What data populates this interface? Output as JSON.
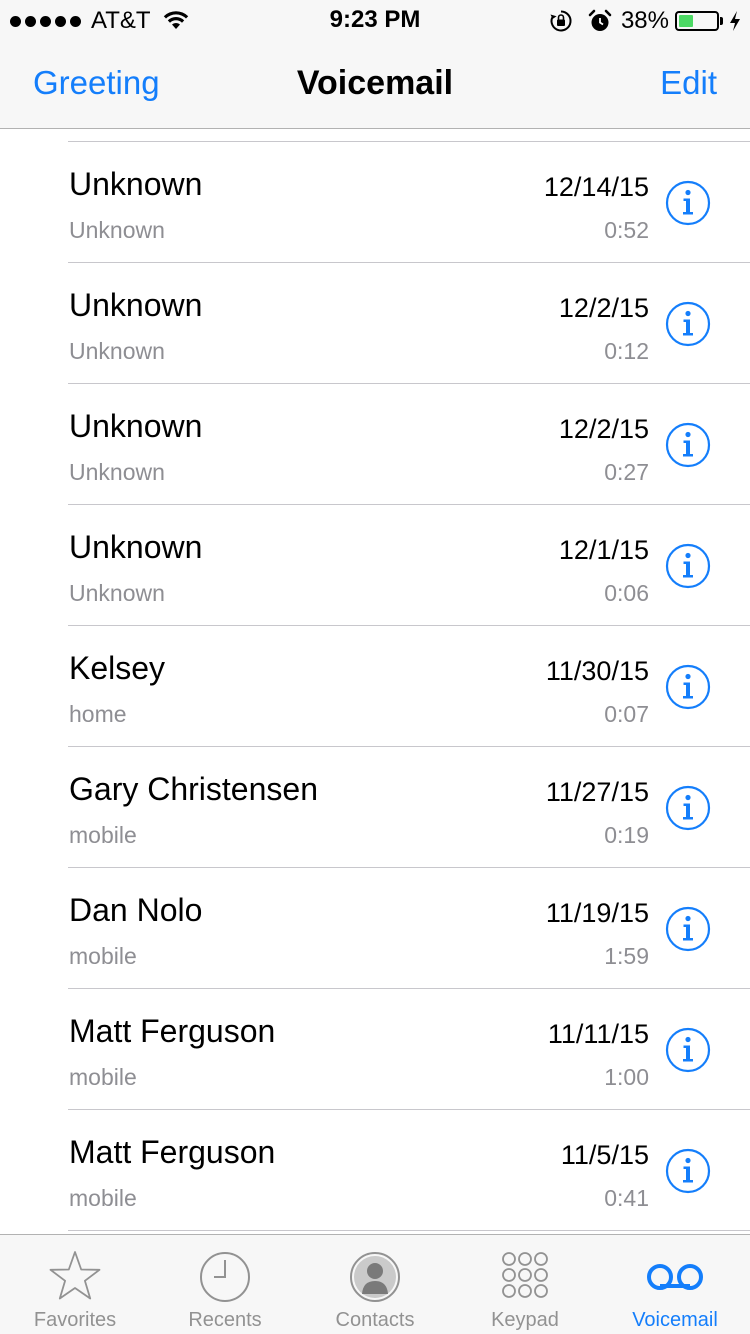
{
  "status_bar": {
    "carrier": "AT&T",
    "time": "9:23 PM",
    "battery_percent": "38%",
    "battery_level": 0.38,
    "icons": [
      "signal-dots",
      "wifi-icon",
      "orientation-lock-icon",
      "alarm-icon",
      "battery-icon",
      "charging-bolt-icon"
    ]
  },
  "nav": {
    "left": "Greeting",
    "title": "Voicemail",
    "right": "Edit"
  },
  "voicemails": [
    {
      "name": "Unknown",
      "label": "Unknown",
      "date": "12/14/15",
      "duration": "0:52"
    },
    {
      "name": "Unknown",
      "label": "Unknown",
      "date": "12/2/15",
      "duration": "0:12"
    },
    {
      "name": "Unknown",
      "label": "Unknown",
      "date": "12/2/15",
      "duration": "0:27"
    },
    {
      "name": "Unknown",
      "label": "Unknown",
      "date": "12/1/15",
      "duration": "0:06"
    },
    {
      "name": "Kelsey",
      "label": "home",
      "date": "11/30/15",
      "duration": "0:07"
    },
    {
      "name": "Gary Christensen",
      "label": "mobile",
      "date": "11/27/15",
      "duration": "0:19"
    },
    {
      "name": "Dan Nolo",
      "label": "mobile",
      "date": "11/19/15",
      "duration": "1:59"
    },
    {
      "name": "Matt Ferguson",
      "label": "mobile",
      "date": "11/11/15",
      "duration": "1:00"
    },
    {
      "name": "Matt Ferguson",
      "label": "mobile",
      "date": "11/5/15",
      "duration": "0:41"
    }
  ],
  "tabs": [
    {
      "label": "Favorites",
      "icon": "star-icon",
      "active": false
    },
    {
      "label": "Recents",
      "icon": "clock-icon",
      "active": false
    },
    {
      "label": "Contacts",
      "icon": "contact-icon",
      "active": false
    },
    {
      "label": "Keypad",
      "icon": "keypad-icon",
      "active": false
    },
    {
      "label": "Voicemail",
      "icon": "voicemail-icon",
      "active": true
    }
  ],
  "colors": {
    "accent": "#147efb",
    "secondary_text": "#8e8e93",
    "battery_fill": "#4cd964",
    "bar_background": "#f7f7f7"
  }
}
